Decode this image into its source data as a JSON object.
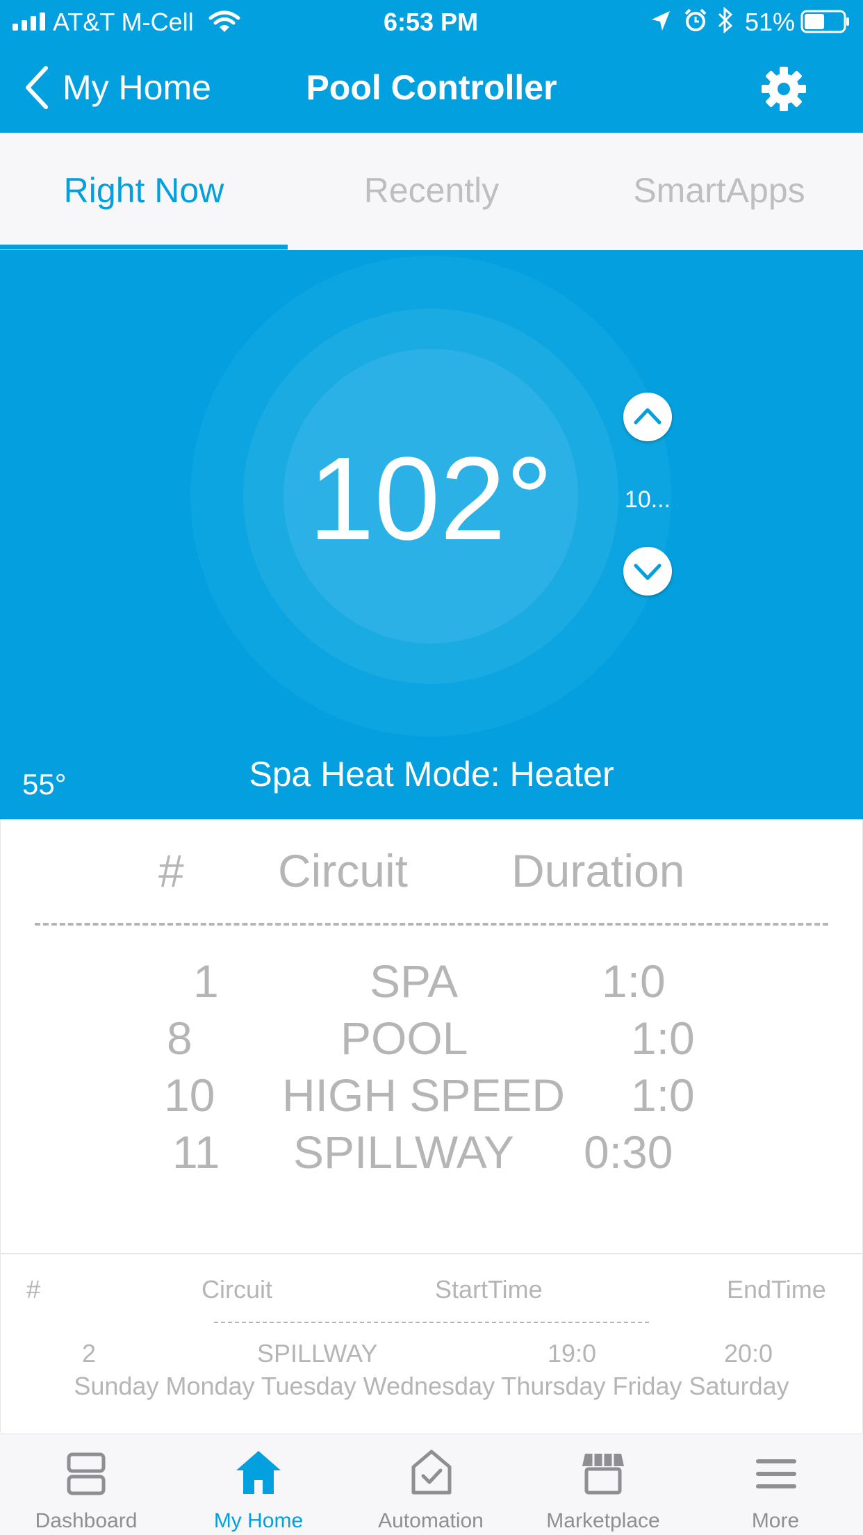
{
  "status_bar": {
    "carrier": "AT&T M-Cell",
    "time": "6:53 PM",
    "battery": "51%",
    "battery_level": 0.51
  },
  "nav": {
    "back_label": "My Home",
    "title": "Pool Controller",
    "settings_icon": "gear-icon"
  },
  "tabs": [
    {
      "label": "Right Now",
      "active": true
    },
    {
      "label": "Recently",
      "active": false
    },
    {
      "label": "SmartApps",
      "active": false
    }
  ],
  "thermostat": {
    "current_temp": "102°",
    "setpoint": "10...",
    "outside_temp": "55°",
    "mode_text": "Spa Heat Mode: Heater",
    "color": "#039FDE"
  },
  "circuit_table": {
    "headers": [
      "#",
      "Circuit",
      "Duration"
    ],
    "divider": "-----------------------------------",
    "rows": [
      {
        "num": "1",
        "circuit": "SPA",
        "duration": "1:0"
      },
      {
        "num": "8",
        "circuit": "POOL",
        "duration": "1:0"
      },
      {
        "num": "10",
        "circuit": "HIGH SPEED",
        "duration": "1:0"
      },
      {
        "num": "11",
        "circuit": "SPILLWAY",
        "duration": "0:30"
      }
    ]
  },
  "schedule_table": {
    "headers": [
      "#",
      "Circuit",
      "StartTime",
      "EndTime"
    ],
    "divider": "-----------------------------------",
    "row": {
      "num": "2",
      "circuit": "SPILLWAY",
      "start": "19:0",
      "end": "20:0"
    },
    "days": "Sunday Monday Tuesday Wednesday Thursday Friday Saturday"
  },
  "bottom_nav": [
    {
      "label": "Dashboard",
      "icon": "dashboard-icon",
      "active": false
    },
    {
      "label": "My Home",
      "icon": "home-icon",
      "active": true
    },
    {
      "label": "Automation",
      "icon": "automation-icon",
      "active": false
    },
    {
      "label": "Marketplace",
      "icon": "marketplace-icon",
      "active": false
    },
    {
      "label": "More",
      "icon": "menu-icon",
      "active": false
    }
  ],
  "colors": {
    "accent": "#03A0DF",
    "inactive": "#8E8E93",
    "table_text": "#B5B5B5"
  }
}
